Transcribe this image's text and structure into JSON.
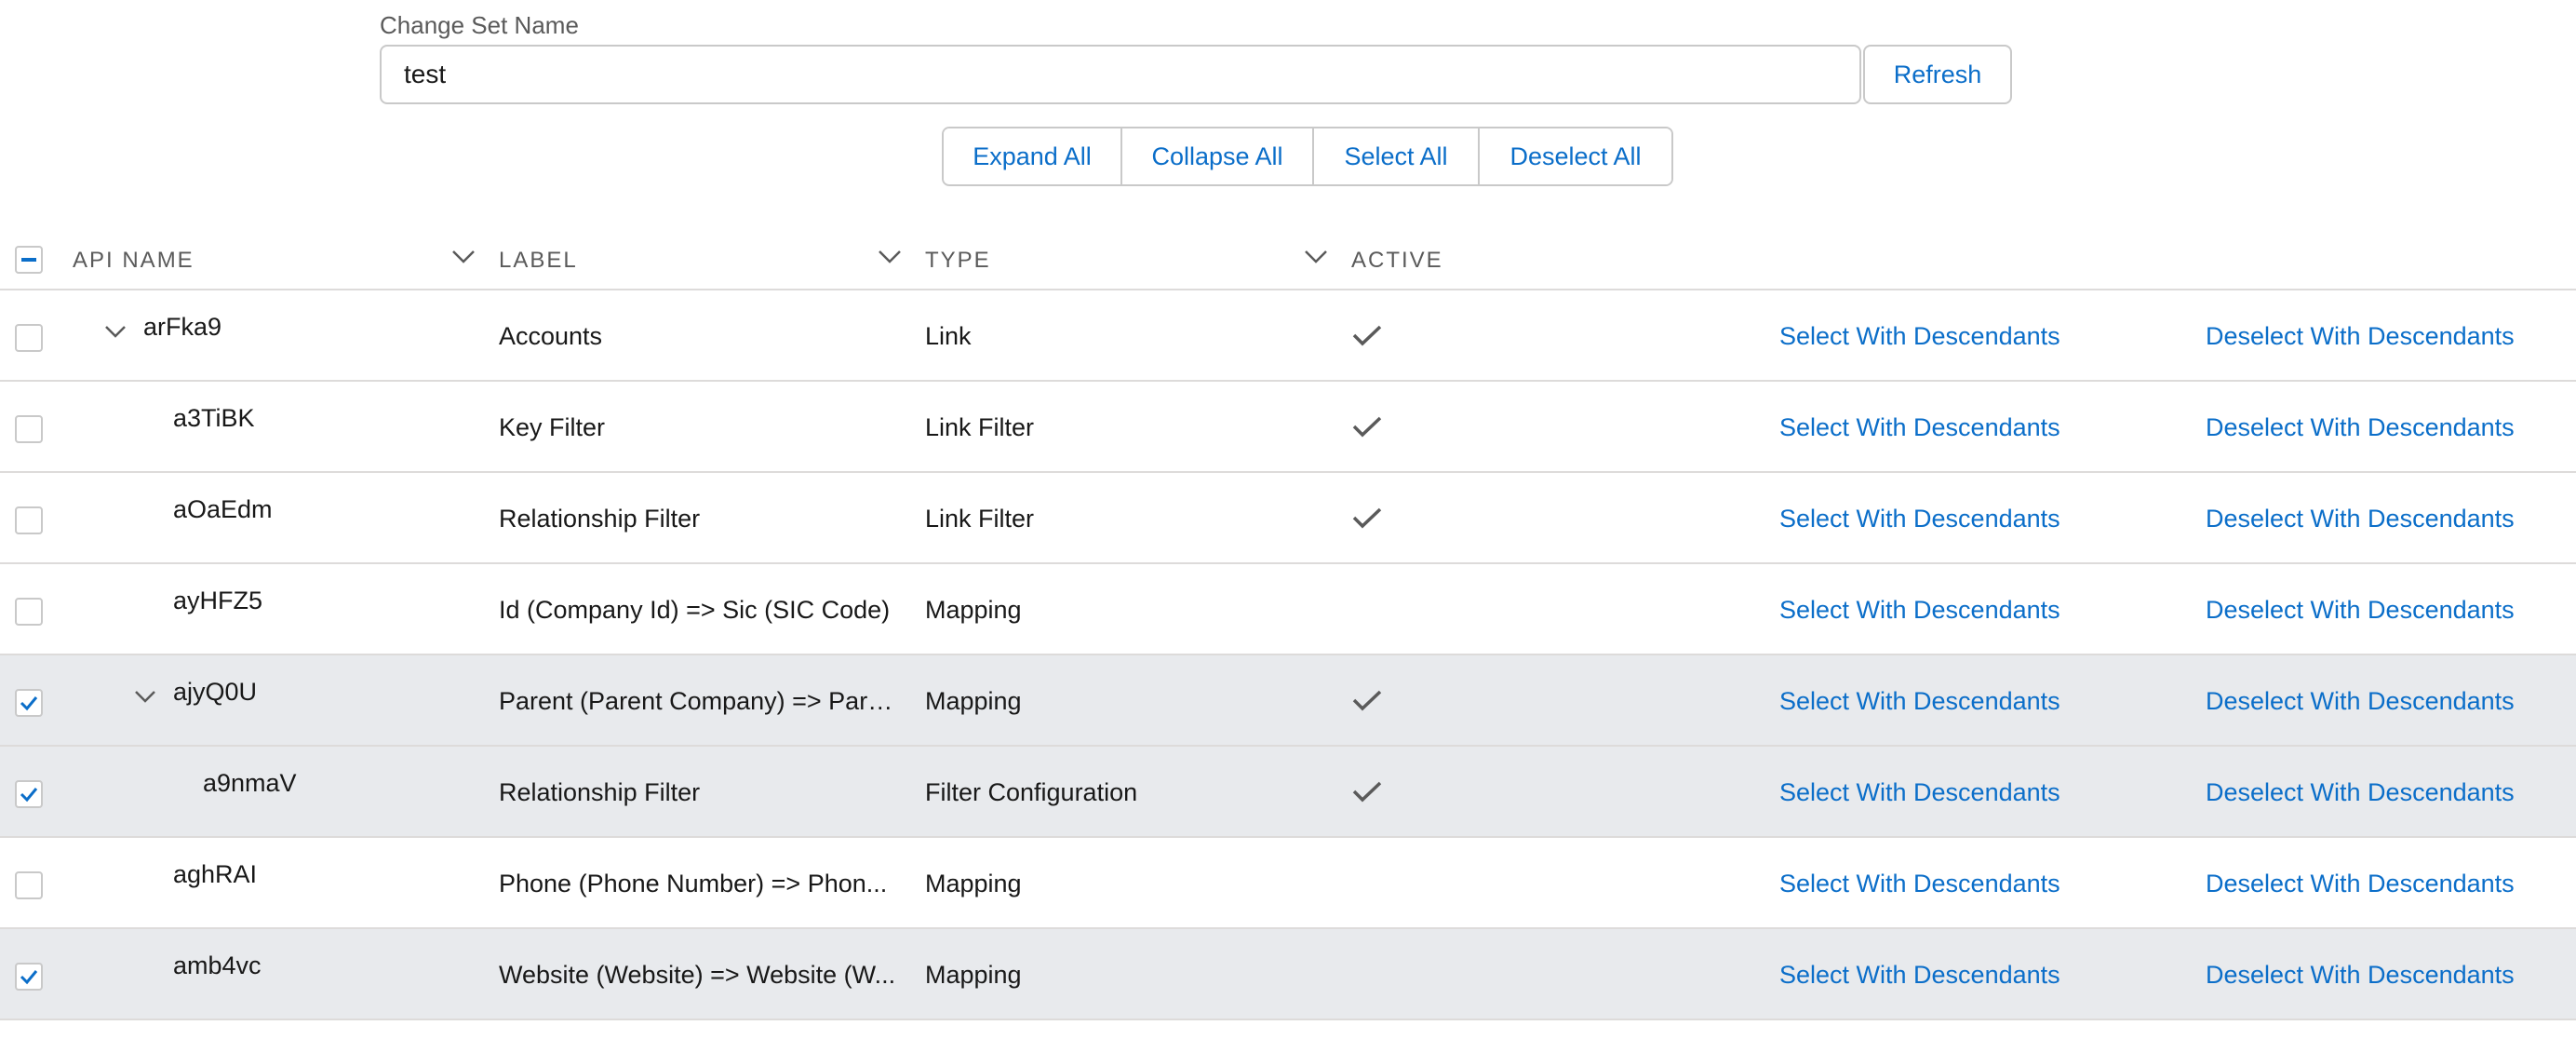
{
  "form": {
    "change_set_label": "Change Set Name",
    "change_set_value": "test",
    "refresh_label": "Refresh"
  },
  "toolbar": {
    "expand_all": "Expand All",
    "collapse_all": "Collapse All",
    "select_all": "Select All",
    "deselect_all": "Deselect All"
  },
  "table": {
    "columns": {
      "api_name": "API NAME",
      "label": "LABEL",
      "type": "TYPE",
      "active": "ACTIVE"
    },
    "row_action_select": "Select With Descendants",
    "row_action_deselect": "Deselect With Descendants",
    "rows": [
      {
        "api_name": "arFka9",
        "label": "Accounts",
        "type": "Link",
        "active": true,
        "selected": false,
        "level": 0,
        "expanded": true
      },
      {
        "api_name": "a3TiBK",
        "label": "Key Filter",
        "type": "Link Filter",
        "active": true,
        "selected": false,
        "level": 1,
        "expanded": null
      },
      {
        "api_name": "aOaEdm",
        "label": "Relationship Filter",
        "type": "Link Filter",
        "active": true,
        "selected": false,
        "level": 1,
        "expanded": null
      },
      {
        "api_name": "ayHFZ5",
        "label": "Id (Company Id) => Sic (SIC Code)",
        "type": "Mapping",
        "active": false,
        "selected": false,
        "level": 1,
        "expanded": null
      },
      {
        "api_name": "ajyQ0U",
        "label": "Parent (Parent Company) => Pare...",
        "type": "Mapping",
        "active": true,
        "selected": true,
        "level": 1,
        "expanded": true
      },
      {
        "api_name": "a9nmaV",
        "label": "Relationship Filter",
        "type": "Filter Configuration",
        "active": true,
        "selected": true,
        "level": 2,
        "expanded": null
      },
      {
        "api_name": "aghRAI",
        "label": "Phone (Phone Number) => Phon...",
        "type": "Mapping",
        "active": false,
        "selected": false,
        "level": 1,
        "expanded": null
      },
      {
        "api_name": "amb4vc",
        "label": "Website (Website) => Website (W...",
        "type": "Mapping",
        "active": false,
        "selected": true,
        "level": 1,
        "expanded": null
      }
    ]
  },
  "colors": {
    "accent": "#0b6ec9",
    "selected_row": "#e8eaed",
    "border": "#dddbda"
  }
}
